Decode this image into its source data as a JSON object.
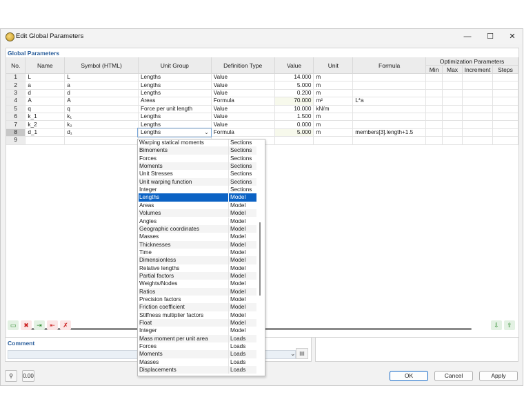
{
  "window": {
    "title": "Edit Global Parameters",
    "minimize": "—",
    "maximize": "☐",
    "close": "✕"
  },
  "panel": {
    "title": "Global Parameters"
  },
  "columns": {
    "no": "No.",
    "name": "Name",
    "symbol": "Symbol (HTML)",
    "unit_group": "Unit Group",
    "definition_type": "Definition Type",
    "value": "Value",
    "unit": "Unit",
    "formula": "Formula",
    "opt_group": "Optimization Parameters",
    "min": "Min",
    "max": "Max",
    "increment": "Increment",
    "steps": "Steps"
  },
  "rows": [
    {
      "no": "1",
      "name": "L",
      "symbol": "L",
      "unit_group": "Lengths",
      "def": "Value",
      "value": "14.000",
      "unit": "m",
      "formula": ""
    },
    {
      "no": "2",
      "name": "a",
      "symbol": "a",
      "unit_group": "Lengths",
      "def": "Value",
      "value": "5.000",
      "unit": "m",
      "formula": ""
    },
    {
      "no": "3",
      "name": "d",
      "symbol": "d",
      "unit_group": "Lengths",
      "def": "Value",
      "value": "0.200",
      "unit": "m",
      "formula": ""
    },
    {
      "no": "4",
      "name": "A",
      "symbol": "A",
      "unit_group": "Areas",
      "def": "Formula",
      "value": "70.000",
      "unit": "m²",
      "formula": "L*a"
    },
    {
      "no": "5",
      "name": "q",
      "symbol": "q",
      "unit_group": "Force per unit length",
      "def": "Value",
      "value": "10.000",
      "unit": "kN/m",
      "formula": ""
    },
    {
      "no": "6",
      "name": "k_1",
      "symbol": "k₁",
      "unit_group": "Lengths",
      "def": "Value",
      "value": "1.500",
      "unit": "m",
      "formula": ""
    },
    {
      "no": "7",
      "name": "k_2",
      "symbol": "k₂",
      "unit_group": "Lengths",
      "def": "Value",
      "value": "0.000",
      "unit": "m",
      "formula": ""
    },
    {
      "no": "8",
      "name": "d_1",
      "symbol": "d₁",
      "unit_group": "Lengths",
      "def": "Formula",
      "value": "5.000",
      "unit": "m",
      "formula": "members[3].length+1.5"
    },
    {
      "no": "9",
      "name": "",
      "symbol": "",
      "unit_group": "",
      "def": "",
      "value": "",
      "unit": "",
      "formula": ""
    }
  ],
  "dropdown": [
    {
      "label": "Warping statical moments",
      "cat": "Sections"
    },
    {
      "label": "Bimoments",
      "cat": "Sections"
    },
    {
      "label": "Forces",
      "cat": "Sections"
    },
    {
      "label": "Moments",
      "cat": "Sections"
    },
    {
      "label": "Unit Stresses",
      "cat": "Sections"
    },
    {
      "label": "Unit warping function",
      "cat": "Sections"
    },
    {
      "label": "Integer",
      "cat": "Sections"
    },
    {
      "label": "Lengths",
      "cat": "Model"
    },
    {
      "label": "Areas",
      "cat": "Model"
    },
    {
      "label": "Volumes",
      "cat": "Model"
    },
    {
      "label": "Angles",
      "cat": "Model"
    },
    {
      "label": "Geographic coordinates",
      "cat": "Model"
    },
    {
      "label": "Masses",
      "cat": "Model"
    },
    {
      "label": "Thicknesses",
      "cat": "Model"
    },
    {
      "label": "Time",
      "cat": "Model"
    },
    {
      "label": "Dimensionless",
      "cat": "Model"
    },
    {
      "label": "Relative lengths",
      "cat": "Model"
    },
    {
      "label": "Partial factors",
      "cat": "Model"
    },
    {
      "label": "Weights/Nodes",
      "cat": "Model"
    },
    {
      "label": "Ratios",
      "cat": "Model"
    },
    {
      "label": "Precision factors",
      "cat": "Model"
    },
    {
      "label": "Friction coefficient",
      "cat": "Model"
    },
    {
      "label": "Stiffness multiplier factors",
      "cat": "Model"
    },
    {
      "label": "Float",
      "cat": "Model"
    },
    {
      "label": "Integer",
      "cat": "Model"
    },
    {
      "label": "Mass moment per unit area",
      "cat": "Loads"
    },
    {
      "label": "Forces",
      "cat": "Loads"
    },
    {
      "label": "Moments",
      "cat": "Loads"
    },
    {
      "label": "Masses",
      "cat": "Loads"
    },
    {
      "label": "Displacements",
      "cat": "Loads"
    }
  ],
  "dropdown_selected_index": 7,
  "comment": {
    "label": "Comment",
    "value": ""
  },
  "buttons": {
    "ok": "OK",
    "cancel": "Cancel",
    "apply": "Apply"
  },
  "colors": {
    "accent": "#0b62c4",
    "panel_title": "#2a5e9b"
  }
}
